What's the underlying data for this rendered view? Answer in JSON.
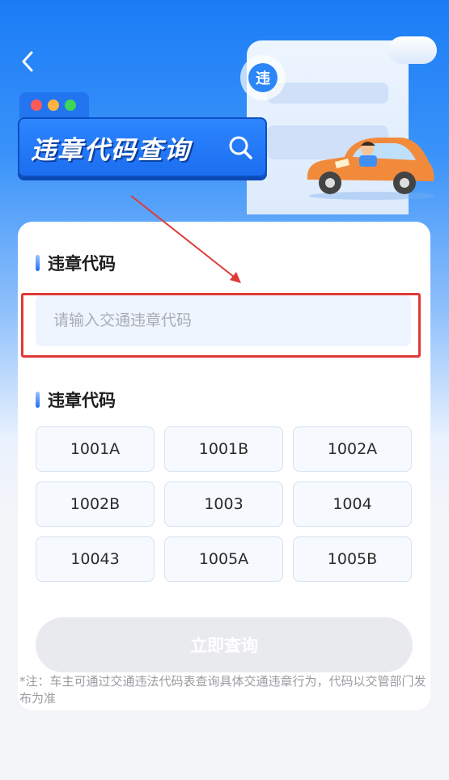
{
  "header": {
    "banner_title": "违章代码查询",
    "badge_char": "违"
  },
  "input_section": {
    "label": "违章代码",
    "placeholder": "请输入交通违章代码"
  },
  "codes_section": {
    "label": "违章代码",
    "codes": [
      "1001A",
      "1001B",
      "1002A",
      "1002B",
      "1003",
      "1004",
      "10043",
      "1005A",
      "1005B"
    ]
  },
  "submit_label": "立即查询",
  "note": "*注：车主可通过交通违法代码表查询具体交通违章行为，代码以交管部门发布为准",
  "colors": {
    "primary": "#1a7cf5",
    "highlight": "#e03a36",
    "disabled_button": "#e9eaee"
  },
  "icons": {
    "back": "chevron-left-icon",
    "search": "search-icon"
  }
}
